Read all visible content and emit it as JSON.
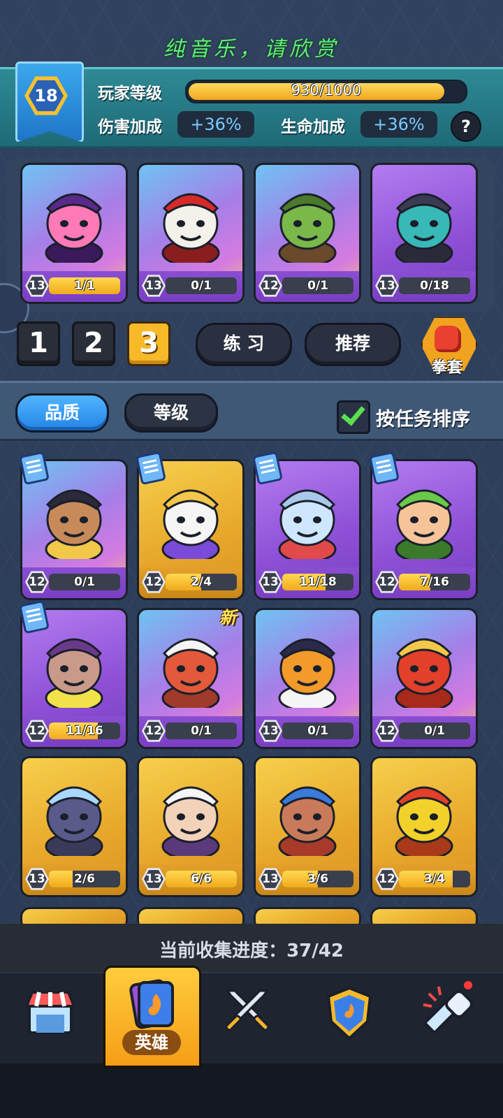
{
  "banner": "纯音乐，请欣赏",
  "player": {
    "level": "18",
    "level_label": "玩家等级",
    "xp_text": "930/1000",
    "xp_progress": 0.93,
    "damage_label": "伤害加成",
    "damage_value": "+36%",
    "health_label": "生命加成",
    "health_value": "+36%",
    "help_icon": "?"
  },
  "deck": [
    {
      "level": "13",
      "progress": "1/1",
      "fill": 1.0,
      "theme": "purple",
      "icon": "witch-hero"
    },
    {
      "level": "13",
      "progress": "0/1",
      "fill": 0.0,
      "theme": "purple",
      "icon": "monkey-king-hero"
    },
    {
      "level": "12",
      "progress": "0/1",
      "fill": 0.0,
      "theme": "purple",
      "icon": "orc-hero"
    },
    {
      "level": "13",
      "progress": "0/18",
      "fill": 0.0,
      "theme": "violet",
      "icon": "frankenstein-hero"
    }
  ],
  "deck_selector": {
    "slots": [
      "1",
      "2",
      "3"
    ],
    "active_slot": "3",
    "practice": "练 习",
    "recommend": "推荐",
    "glove_label": "拳套"
  },
  "filters": {
    "quality": "品质",
    "level": "等级",
    "sort_label": "按任务排序",
    "sort_checked": true
  },
  "heroes": [
    {
      "level": "12",
      "progress": "0/1",
      "fill": 0.0,
      "theme": "purple",
      "task": true,
      "icon": "pirate-hero"
    },
    {
      "level": "12",
      "progress": "2/4",
      "fill": 0.5,
      "theme": "gold",
      "task": true,
      "icon": "cat-priest-hero"
    },
    {
      "level": "13",
      "progress": "11/18",
      "fill": 0.61,
      "theme": "violet",
      "task": true,
      "icon": "yeti-hero"
    },
    {
      "level": "12",
      "progress": "7/16",
      "fill": 0.44,
      "theme": "violet",
      "task": true,
      "icon": "dryad-hero"
    },
    {
      "level": "12",
      "progress": "11/16",
      "fill": 0.69,
      "theme": "violet",
      "task": true,
      "icon": "gorilla-hero"
    },
    {
      "level": "12",
      "progress": "0/1",
      "fill": 0.0,
      "theme": "purple",
      "task": false,
      "new": "新",
      "icon": "dragon-chef-hero"
    },
    {
      "level": "13",
      "progress": "0/1",
      "fill": 0.0,
      "theme": "purple",
      "task": false,
      "icon": "pumpkin-hero"
    },
    {
      "level": "12",
      "progress": "0/1",
      "fill": 0.0,
      "theme": "purple",
      "task": false,
      "icon": "phoenix-hero"
    },
    {
      "level": "13",
      "progress": "2/6",
      "fill": 0.33,
      "theme": "gold",
      "task": false,
      "icon": "storm-golem-hero"
    },
    {
      "level": "13",
      "progress": "6/6",
      "fill": 1.0,
      "theme": "gold",
      "task": false,
      "icon": "old-sage-hero"
    },
    {
      "level": "13",
      "progress": "3/6",
      "fill": 0.5,
      "theme": "gold",
      "task": false,
      "icon": "tribal-archer-hero"
    },
    {
      "level": "12",
      "progress": "3/4",
      "fill": 0.75,
      "theme": "gold",
      "task": false,
      "icon": "rooster-boxer-hero"
    }
  ],
  "collection": "当前收集进度：37/42",
  "nav": {
    "items": [
      {
        "name": "shop",
        "icon": "shop-icon"
      },
      {
        "name": "heroes",
        "icon": "hero-cards-icon",
        "label": "英雄",
        "active": true
      },
      {
        "name": "battle",
        "icon": "crossed-swords-icon"
      },
      {
        "name": "clan",
        "icon": "shield-badge-icon"
      },
      {
        "name": "events",
        "icon": "fist-punch-icon"
      }
    ]
  },
  "colors": {
    "accent_gold": "#f8b928",
    "xp_fill": "#f1a81e",
    "bonus_text": "#79cbff",
    "banner_green": "#5ef07a"
  }
}
